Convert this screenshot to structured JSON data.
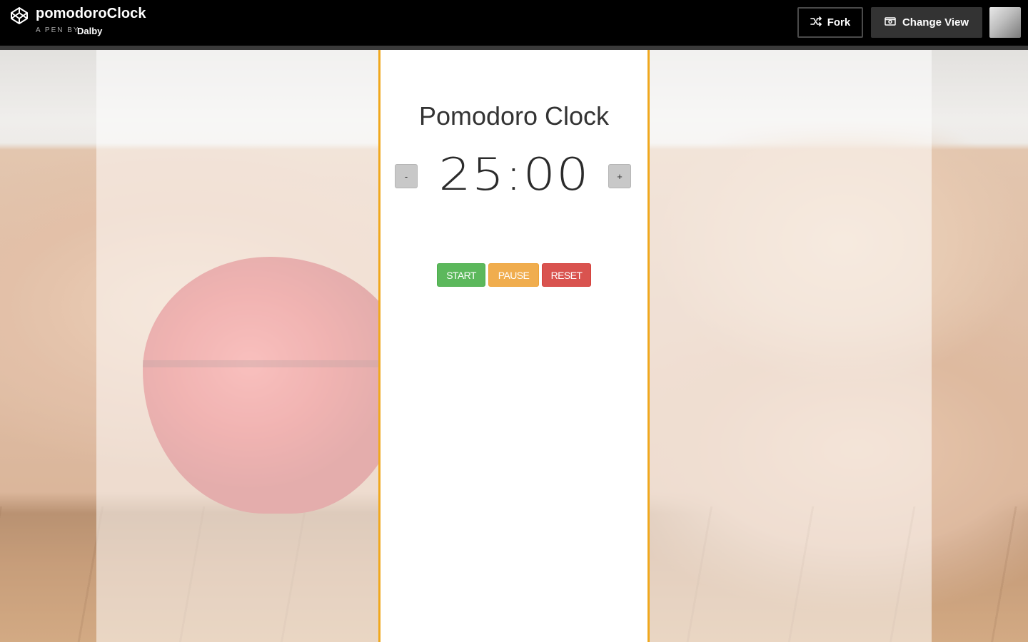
{
  "header": {
    "pen_title": "pomodoroClock",
    "byline_prefix": "A PEN BY",
    "author": "Dalby",
    "fork_label": "Fork",
    "change_view_label": "Change View"
  },
  "clock": {
    "title": "Pomodoro Clock",
    "decrease_label": "-",
    "increase_label": "+",
    "time": "25:00",
    "start_label": "START",
    "pause_label": "PAUSE",
    "reset_label": "RESET"
  },
  "colors": {
    "panel_border": "#f0a81e",
    "start": "#5cb85c",
    "pause": "#f0ad4e",
    "reset": "#d9534f",
    "topbar": "#000000"
  },
  "icons": {
    "logo": "codepen-logo-icon",
    "fork": "fork-icon",
    "change_view": "change-view-icon"
  }
}
